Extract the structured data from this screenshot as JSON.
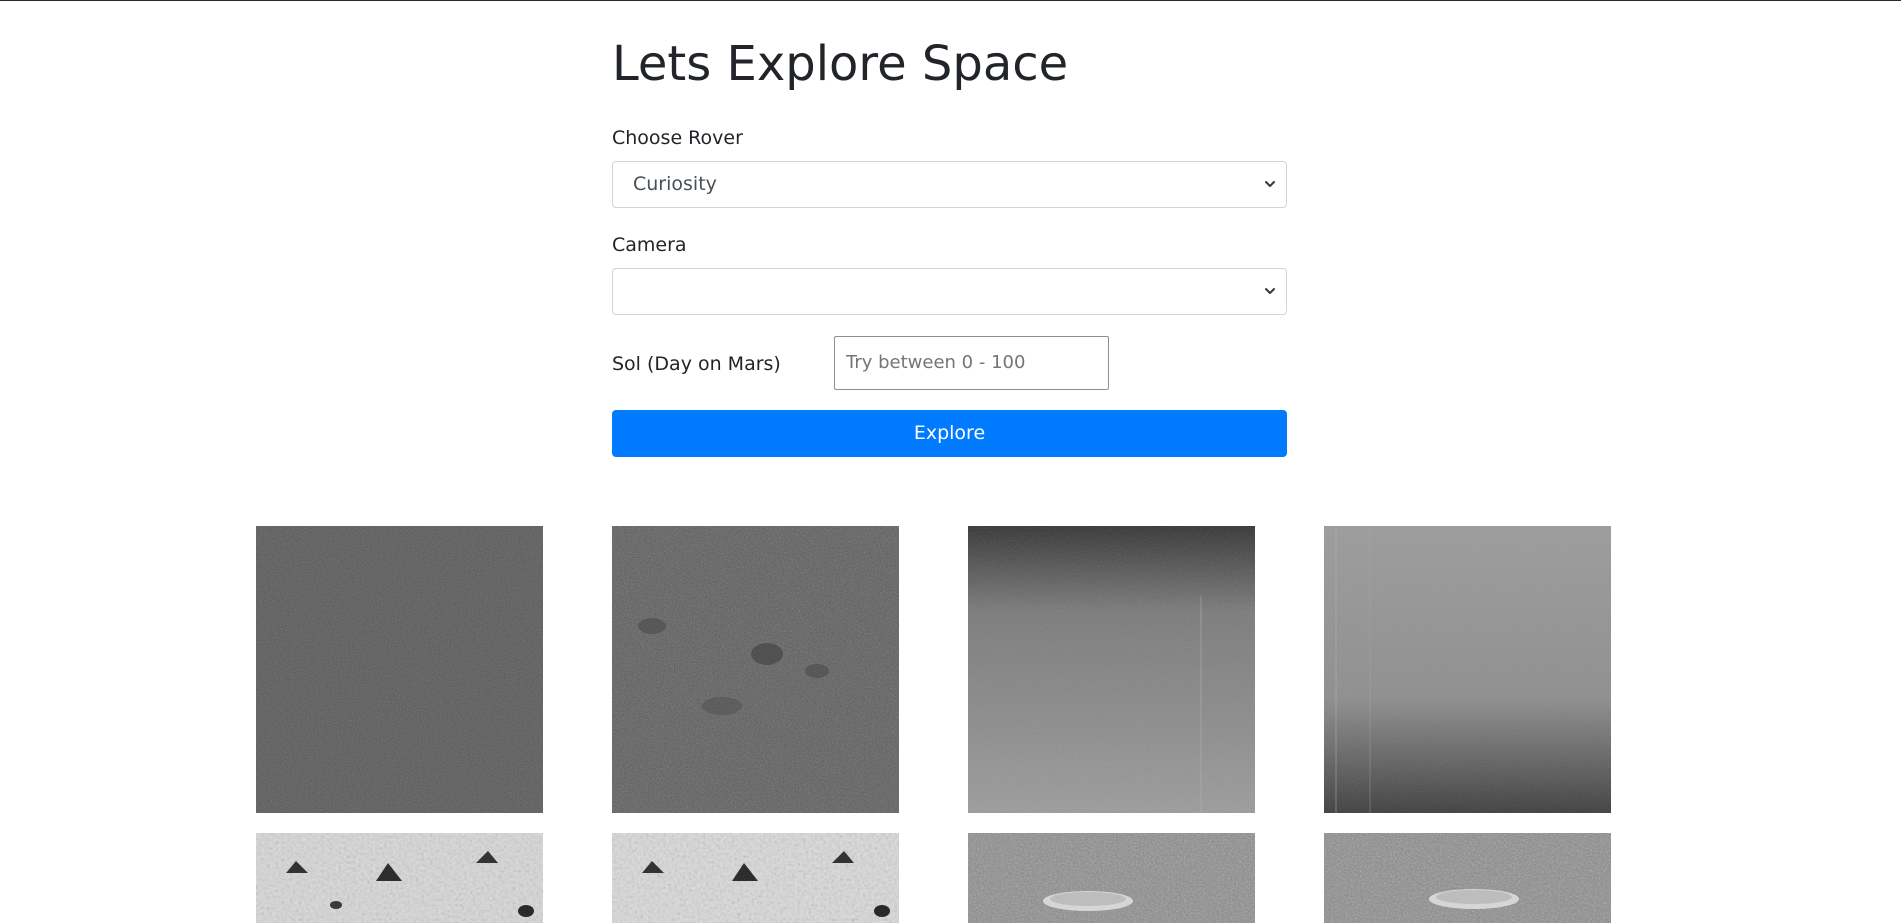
{
  "page": {
    "title": "Lets Explore Space"
  },
  "form": {
    "rover_label": "Choose Rover",
    "rover_selected": "Curiosity",
    "camera_label": "Camera",
    "camera_selected": "",
    "sol_label": "Sol (Day on Mars)",
    "sol_placeholder": "Try between 0 - 100",
    "explore_label": "Explore"
  },
  "colors": {
    "primary_button": "#007bff",
    "text": "#212529",
    "input_border": "#ced4da"
  },
  "icons": {
    "select_chevron": "chevron-down-icon"
  },
  "photos": [
    {
      "alt": "mars-photo-1"
    },
    {
      "alt": "mars-photo-2"
    },
    {
      "alt": "mars-photo-3"
    },
    {
      "alt": "mars-photo-4"
    },
    {
      "alt": "mars-photo-5"
    },
    {
      "alt": "mars-photo-6"
    },
    {
      "alt": "mars-photo-7"
    },
    {
      "alt": "mars-photo-8"
    }
  ]
}
